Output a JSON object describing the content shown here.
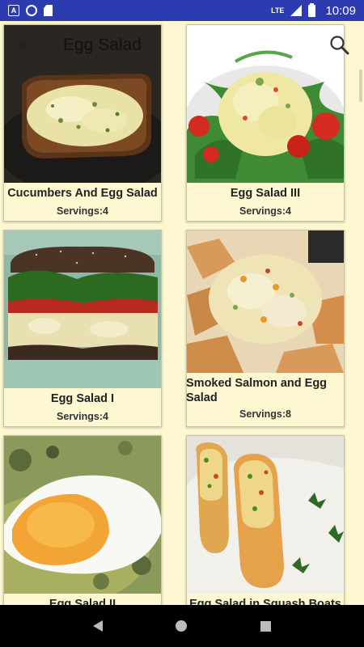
{
  "status_bar": {
    "time": "10:09",
    "network": "LTE",
    "left_icons": [
      "notification-a-icon",
      "sync-circle-icon",
      "sd-card-icon"
    ],
    "right_icons": [
      "lte-icon",
      "signal-icon",
      "battery-icon"
    ]
  },
  "toolbar": {
    "title": "Egg Salad",
    "back_icon": "arrow-left-icon",
    "search_icon": "search-icon"
  },
  "recipes": [
    {
      "name": "Cucumbers And Egg Salad",
      "servings": "Servings:4"
    },
    {
      "name": "Egg Salad III",
      "servings": "Servings:4"
    },
    {
      "name": "Egg Salad I",
      "servings": "Servings:4"
    },
    {
      "name": "Smoked Salmon and Egg Salad",
      "servings": "Servings:8"
    },
    {
      "name": "Egg Salad II",
      "servings": ""
    },
    {
      "name": "Egg Salad in Squash Boats",
      "servings": ""
    }
  ],
  "nav_bar": {
    "icons": [
      "nav-back-icon",
      "nav-home-icon",
      "nav-recent-icon"
    ]
  },
  "colors": {
    "status_bar": "#2d3bb0",
    "background": "#fdf8d2",
    "card_border": "#c9c4a4"
  }
}
